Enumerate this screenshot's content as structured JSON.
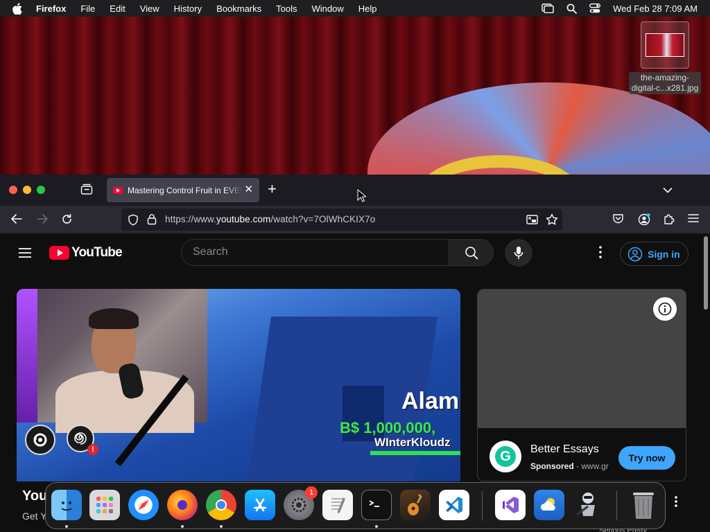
{
  "menubar": {
    "app_name": "Firefox",
    "menus": [
      "File",
      "Edit",
      "View",
      "History",
      "Bookmarks",
      "Tools",
      "Window",
      "Help"
    ],
    "datetime": "Wed Feb 28  7:09 AM"
  },
  "desktop": {
    "file_name_line1": "the-amazing-",
    "file_name_line2": "digital-c...x281.jpg"
  },
  "browser": {
    "tab_title": "Mastering Control Fruit in EVERY",
    "url_prefix": "https://www.",
    "url_domain": "youtube.com",
    "url_path": "/watch?v=7OlWhCKIX7o",
    "colors": {
      "tabbar": "#1c1b22",
      "toolbar": "#2b2a33",
      "urlbar": "#1c1b22"
    }
  },
  "youtube": {
    "logo_text": "YouTube",
    "search_placeholder": "Search",
    "sign_in_label": "Sign in",
    "accent": "#3ea6ff",
    "video_overlay": {
      "big_text": "Alam",
      "money_text": "B$ 1,000,000,",
      "player_name": "WInterKloudz",
      "alert_badge": "!"
    },
    "ad": {
      "title": "Better Essays",
      "sponsored_label": "Sponsored",
      "separator": "·",
      "domain": "www.gr",
      "cta_label": "Try now",
      "logo_letter": "G"
    },
    "below_title": "You",
    "below_sub": "Get Y",
    "below_right": "Serious Pretty"
  },
  "dock": {
    "items": [
      {
        "icon": "finder-icon",
        "running": true
      },
      {
        "icon": "launchpad-icon",
        "running": false
      },
      {
        "icon": "safari-icon",
        "running": false
      },
      {
        "icon": "firefox-icon",
        "running": true
      },
      {
        "icon": "chrome-icon",
        "running": true
      },
      {
        "icon": "app-store-icon",
        "running": false
      },
      {
        "icon": "system-settings-icon",
        "running": false,
        "badge": "1"
      },
      {
        "icon": "textedit-icon",
        "running": false
      },
      {
        "icon": "terminal-icon",
        "running": true
      },
      {
        "icon": "garageband-icon",
        "running": false
      },
      {
        "icon": "vscode-icon",
        "running": false
      },
      {
        "icon": "visual-studio-icon",
        "running": false
      },
      {
        "icon": "weather-icon",
        "running": false
      },
      {
        "icon": "automator-icon",
        "running": false
      },
      {
        "icon": "trash-icon",
        "running": false
      }
    ]
  }
}
